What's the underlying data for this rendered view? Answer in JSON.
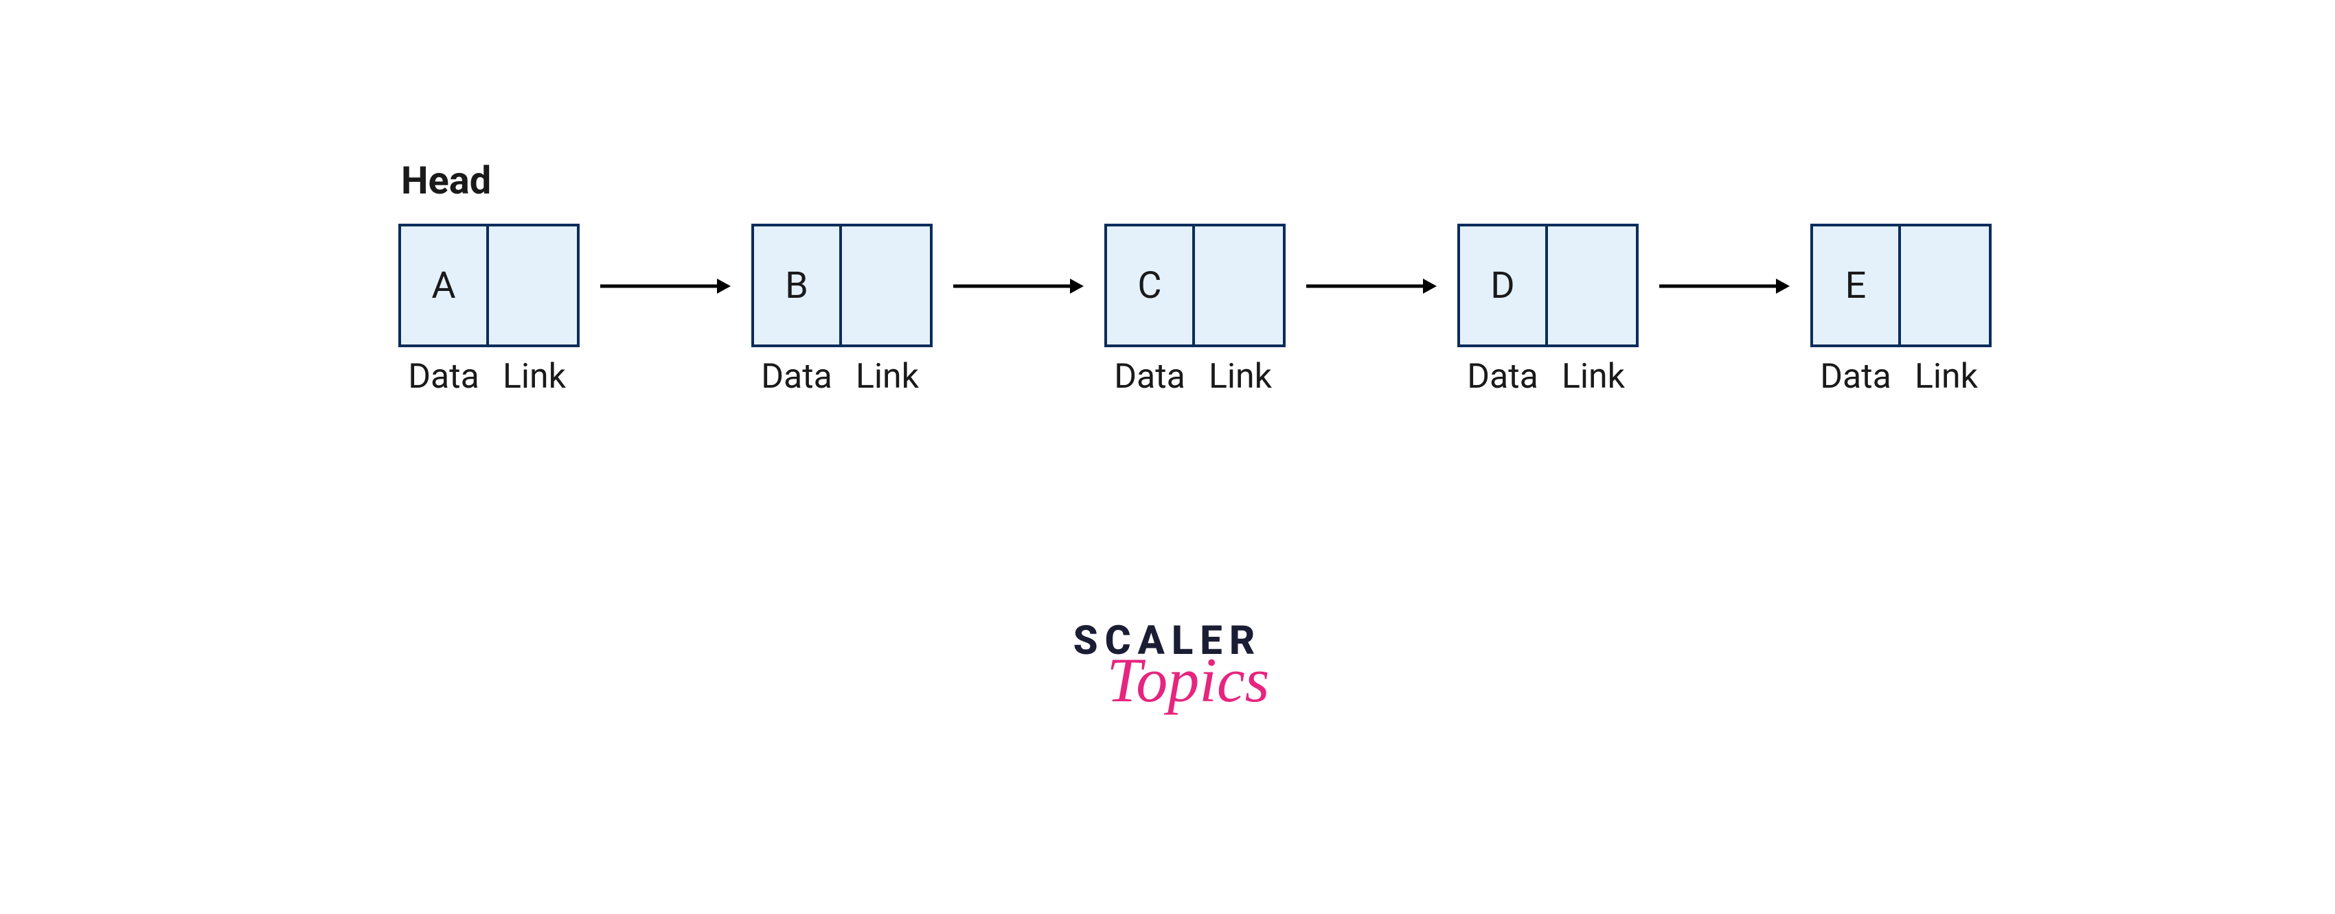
{
  "diagram": {
    "head_label": "Head",
    "data_sublabel": "Data",
    "link_sublabel": "Link",
    "nodes": [
      {
        "value": "A"
      },
      {
        "value": "B"
      },
      {
        "value": "C"
      },
      {
        "value": "D"
      },
      {
        "value": "E"
      }
    ]
  },
  "branding": {
    "line1": "SCALER",
    "line2": "Topics"
  },
  "colors": {
    "node_border": "#0b2d5b",
    "node_fill": "#e4f1fb",
    "text": "#1a1a1a",
    "logo_dark": "#1b1d35",
    "logo_pink": "#e6257f"
  }
}
